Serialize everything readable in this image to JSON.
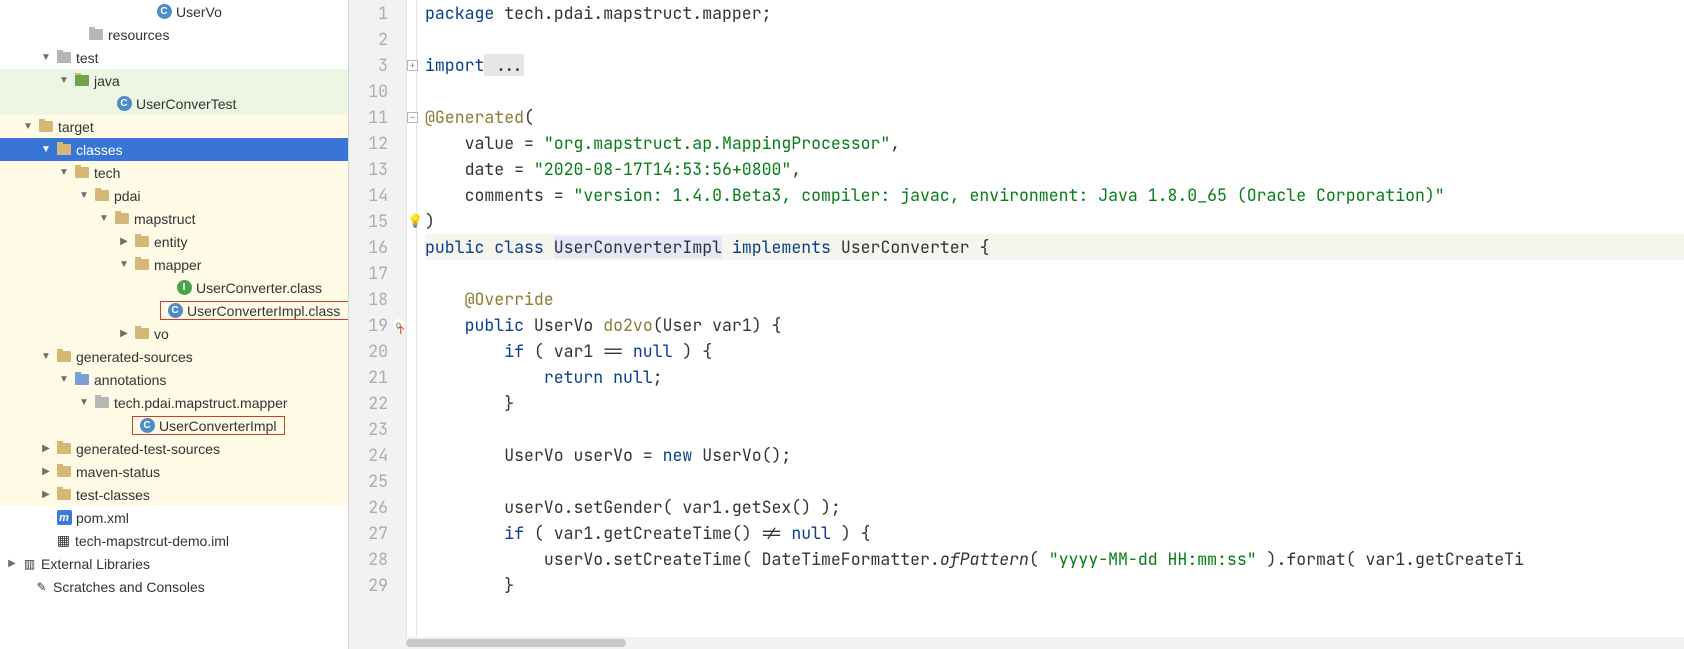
{
  "tree": {
    "uservo": "UserVo",
    "resources": "resources",
    "test": "test",
    "java": "java",
    "userconvertest": "UserConverTest",
    "target": "target",
    "classes": "classes",
    "tech": "tech",
    "pdai": "pdai",
    "mapstruct": "mapstruct",
    "entity": "entity",
    "mapper": "mapper",
    "userconverter_class": "UserConverter.class",
    "userconverterimpl_class": "UserConverterImpl.class",
    "vo": "vo",
    "generated_sources": "generated-sources",
    "annotations": "annotations",
    "tech_pkg": "tech.pdai.mapstruct.mapper",
    "userconverterimpl": "UserConverterImpl",
    "generated_test_sources": "generated-test-sources",
    "maven_status": "maven-status",
    "test_classes": "test-classes",
    "pom": "pom.xml",
    "iml": "tech-mapstrcut-demo.iml",
    "ext_lib": "External Libraries",
    "scratches": "Scratches and Consoles"
  },
  "lines": [
    "1",
    "2",
    "3",
    "10",
    "11",
    "12",
    "13",
    "14",
    "15",
    "16",
    "17",
    "18",
    "19",
    "20",
    "21",
    "22",
    "23",
    "24",
    "25",
    "26",
    "27",
    "28",
    "29"
  ],
  "code": {
    "package_kw": "package",
    "package_val": " tech.pdai.mapstruct.mapper;",
    "import_kw": "import",
    "import_rest": " ...",
    "gen": "@Generated",
    "gen_open": "(",
    "value_lbl": "    value = ",
    "value_str": "\"org.mapstruct.ap.MappingProcessor\"",
    "comma1": ",",
    "date_lbl": "    date = ",
    "date_str": "\"2020-08-17T14:53:56+0800\"",
    "comma2": ",",
    "comments_lbl": "    comments = ",
    "comments_str": "\"version: 1.4.0.Beta3, compiler: javac, environment: Java 1.8.0_65 (Oracle Corporation)\"",
    "gen_close": ")",
    "public_kw": "public",
    "class_kw": " class ",
    "class_name": "UserConverterImpl",
    "implements_kw": " implements ",
    "iface": "UserConverter {",
    "override": "@Override",
    "m_public": "public ",
    "m_ret": "UserVo ",
    "m_name": "do2vo",
    "m_args": "(User var1) {",
    "if1": "if ",
    "if1_cond": "( var1 == ",
    "null_kw": "null",
    "if1_close": " ) {",
    "return_kw": "return ",
    "return_rest": ";",
    "brace": "}",
    "decl_type": "UserVo userVo = ",
    "new_kw": "new ",
    "ctor": "UserVo();",
    "set1": "userVo.setGender( var1.getSex() );",
    "if2_a": "if ",
    "if2_b": "( var1.getCreateTime() != ",
    "if2_c": " ) {",
    "set2_a": "userVo.setCreateTime( DateTimeFormatter.",
    "set2_b": "ofPattern",
    "set2_c": "( ",
    "set2_str": "\"yyyy-MM-dd HH:mm:ss\"",
    "set2_d": " ).format( var1.getCreateTi"
  }
}
